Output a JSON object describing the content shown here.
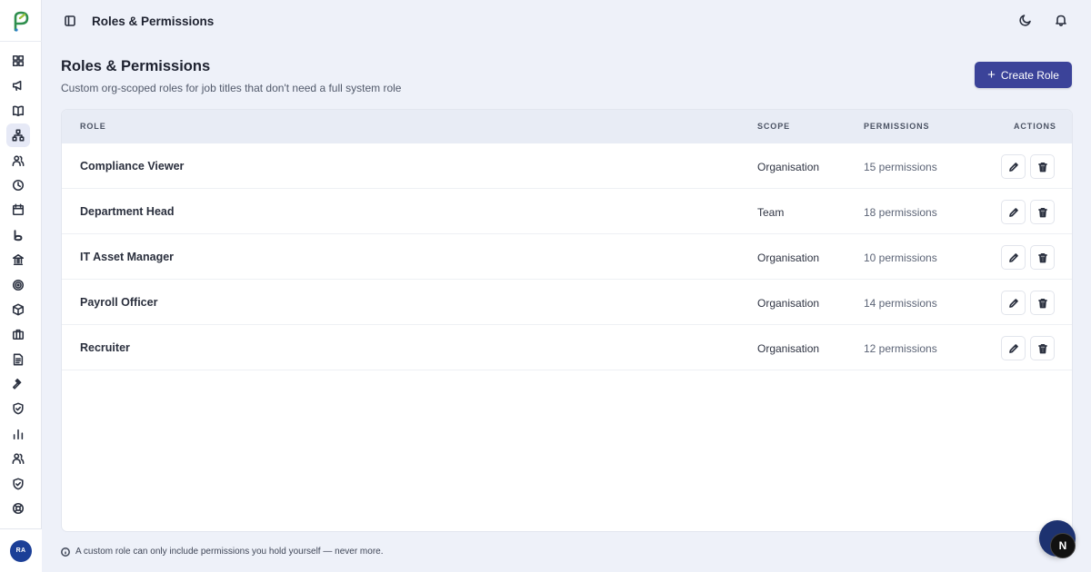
{
  "app": {
    "colors": {
      "accent": "#3b4399",
      "background": "#eef1f9",
      "card": "#ffffff",
      "table_header_bg": "#e8ecf5",
      "avatar_bg": "#1b3f97"
    }
  },
  "topbar": {
    "title": "Roles & Permissions",
    "icons": [
      "sidebar-toggle-icon",
      "moon-icon",
      "bell-icon"
    ]
  },
  "sidebar": {
    "logo": "app-logo",
    "items": [
      {
        "icon": "dashboard-icon"
      },
      {
        "icon": "megaphone-icon"
      },
      {
        "icon": "book-icon"
      },
      {
        "icon": "org-chart-icon",
        "active": true
      },
      {
        "icon": "users-icon"
      },
      {
        "icon": "clock-icon"
      },
      {
        "icon": "calendar-icon"
      },
      {
        "icon": "b-logo-icon"
      },
      {
        "icon": "bank-icon"
      },
      {
        "icon": "target-icon"
      },
      {
        "icon": "box-icon"
      },
      {
        "icon": "briefcase-icon"
      },
      {
        "icon": "document-icon"
      },
      {
        "icon": "gavel-icon"
      },
      {
        "icon": "shield-check-icon"
      },
      {
        "icon": "bar-chart-icon"
      },
      {
        "icon": "team-icon"
      },
      {
        "icon": "shield-icon"
      },
      {
        "icon": "lifebuoy-icon"
      }
    ],
    "user_initials": "RA"
  },
  "page": {
    "title": "Roles & Permissions",
    "subtitle": "Custom org-scoped roles for job titles that don't need a full system role",
    "create_button": "Create Role"
  },
  "table": {
    "headers": {
      "role": "ROLE",
      "scope": "SCOPE",
      "permissions": "PERMISSIONS",
      "actions": "ACTIONS"
    },
    "rows": [
      {
        "role": "Compliance Viewer",
        "scope": "Organisation",
        "permissions": "15 permissions"
      },
      {
        "role": "Department Head",
        "scope": "Team",
        "permissions": "18 permissions"
      },
      {
        "role": "IT Asset Manager",
        "scope": "Organisation",
        "permissions": "10 permissions"
      },
      {
        "role": "Payroll Officer",
        "scope": "Organisation",
        "permissions": "14 permissions"
      },
      {
        "role": "Recruiter",
        "scope": "Organisation",
        "permissions": "12 permissions"
      }
    ]
  },
  "footer": {
    "note": "A custom role can only include permissions you hold yourself — never more."
  },
  "widget": {
    "label": "N"
  }
}
